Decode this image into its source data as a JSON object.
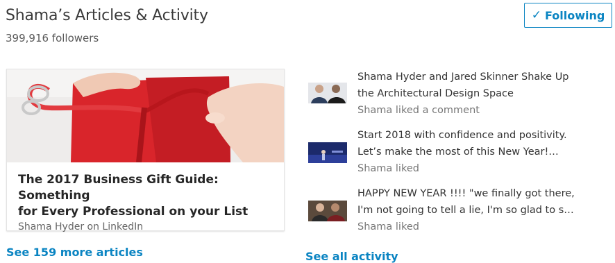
{
  "header": {
    "title": "Shama’s Articles & Activity",
    "followers": "399,916 followers",
    "follow_button": {
      "check": "✓",
      "label": "Following"
    }
  },
  "article": {
    "title_line1": "The 2017 Business Gift Guide: Something",
    "title_line2": "for Every Professional on your List",
    "source": "Shama Hyder on LinkedIn"
  },
  "links": {
    "see_more_articles": "See 159 more articles",
    "see_all_activity": "See all activity"
  },
  "activity": [
    {
      "line1": "Shama Hyder and Jared Skinner Shake Up",
      "line2": "the Architectural Design Space",
      "meta": "Shama liked a comment"
    },
    {
      "line1": "Start 2018 with confidence and positivity.",
      "line2": "Let’s make the most of this New Year!…",
      "meta": "Shama liked"
    },
    {
      "line1": "HAPPY NEW YEAR !!!! \"we finally got there,",
      "line2": "I'm not going to tell a lie, I'm so glad to s…",
      "meta": "Shama liked"
    }
  ],
  "colors": {
    "accent": "#0a84c2",
    "ribbon": "#d9252b"
  }
}
